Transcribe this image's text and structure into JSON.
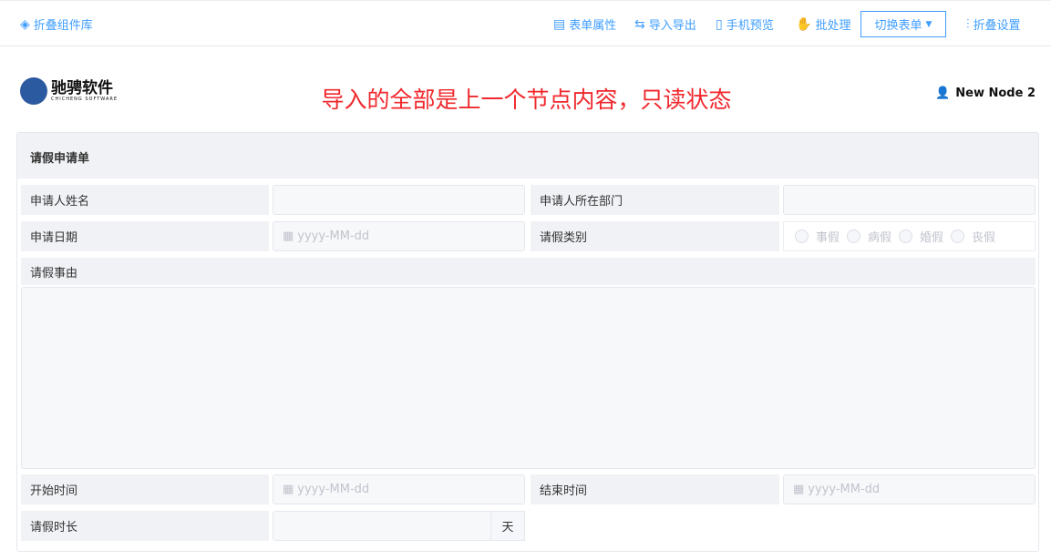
{
  "toolbar": {
    "collapse_library": "折叠组件库",
    "form_props": "表单属性",
    "import_export": "导入导出",
    "mobile_preview": "手机预览",
    "batch": "批处理",
    "switch_form": "切换表单",
    "collapse_settings": "折叠设置"
  },
  "header": {
    "logo_cn": "驰骋软件",
    "logo_en": "CHICHENG SOFTWARE",
    "notice": "导入的全部是上一个节点内容，只读状态",
    "user": "New Node 2"
  },
  "form": {
    "title": "请假申请单",
    "fields": {
      "name": "申请人姓名",
      "dept": "申请人所在部门",
      "date": "申请日期",
      "type": "请假类别",
      "reason": "请假事由",
      "start": "开始时间",
      "end": "结束时间",
      "duration": "请假时长"
    },
    "date_placeholder": "yyyy-MM-dd",
    "duration_unit": "天",
    "leave_types": [
      "事假",
      "病假",
      "婚假",
      "丧假"
    ]
  },
  "colors": {
    "accent": "#409eff",
    "notice": "#f0282d"
  }
}
